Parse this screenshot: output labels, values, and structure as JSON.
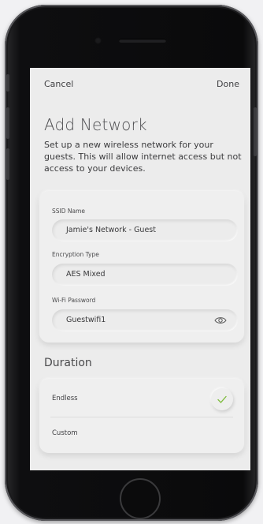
{
  "nav": {
    "cancel": "Cancel",
    "done": "Done"
  },
  "page": {
    "title": "Add Network",
    "description": "Set up a new wireless network for your guests. This will allow internet access but not access to your devices."
  },
  "fields": {
    "ssid": {
      "label": "SSID Name",
      "value": "Jamie's Network - Guest"
    },
    "encryption": {
      "label": "Encryption Type",
      "value": "AES Mixed"
    },
    "password": {
      "label": "Wi-Fi Password",
      "value": "Guestwifi1",
      "icon": "eye-icon"
    }
  },
  "duration": {
    "title": "Duration",
    "options": [
      {
        "label": "Endless",
        "selected": true
      },
      {
        "label": "Custom",
        "selected": false
      }
    ]
  },
  "colors": {
    "check": "#7dbb3c",
    "screen_bg": "#ececec",
    "phone": "#0a0a0b"
  }
}
